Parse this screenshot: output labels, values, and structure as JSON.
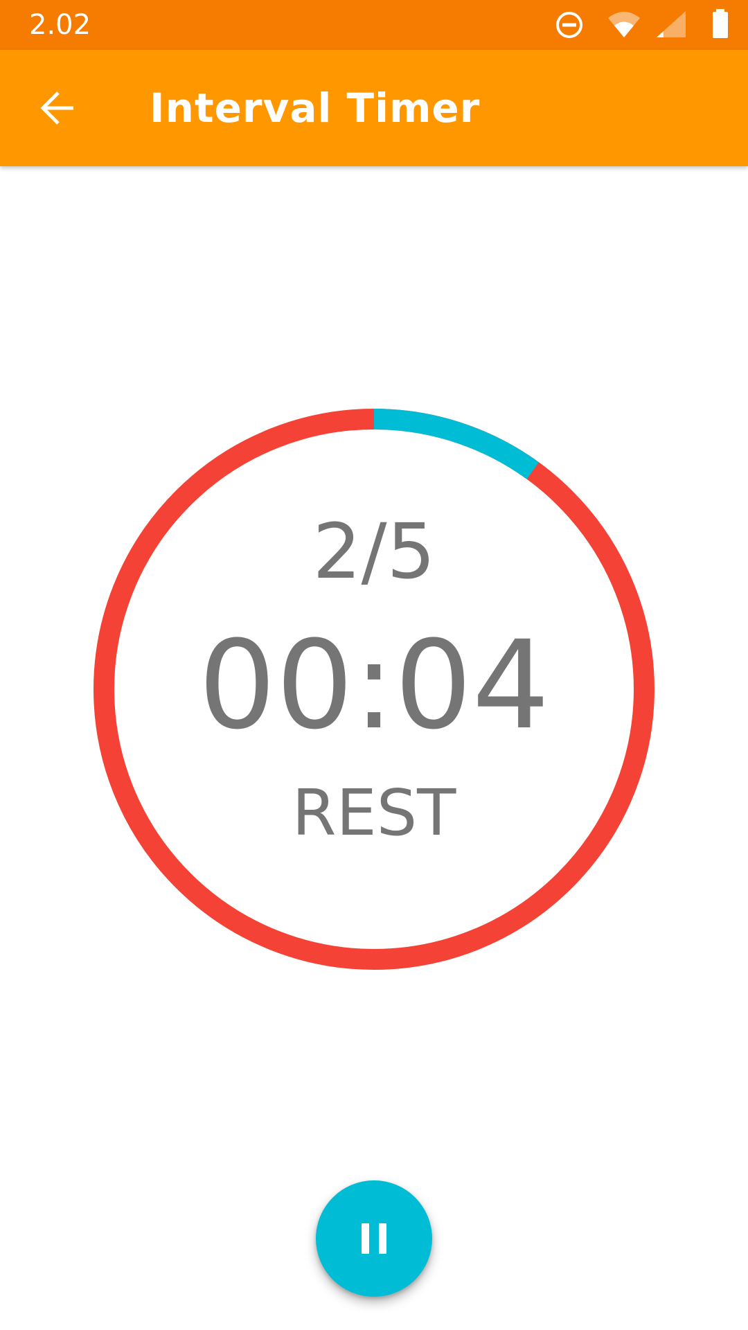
{
  "status_bar": {
    "time": "2.02",
    "icons": [
      "do-not-disturb-icon",
      "wifi-icon",
      "cellular-signal-icon",
      "battery-icon"
    ]
  },
  "app_bar": {
    "title": "Interval Timer",
    "back_icon": "arrow-back-icon"
  },
  "timer": {
    "round": "2/5",
    "time": "00:04",
    "phase": "REST",
    "progress_fraction": 0.1
  },
  "fab": {
    "icon": "pause-icon"
  },
  "colors": {
    "status_bar": "#F57C00",
    "app_bar": "#FF9800",
    "ring_remaining": "#F44336",
    "ring_progress": "#00BCD4",
    "text_secondary": "#757575",
    "fab": "#00BCD4"
  }
}
